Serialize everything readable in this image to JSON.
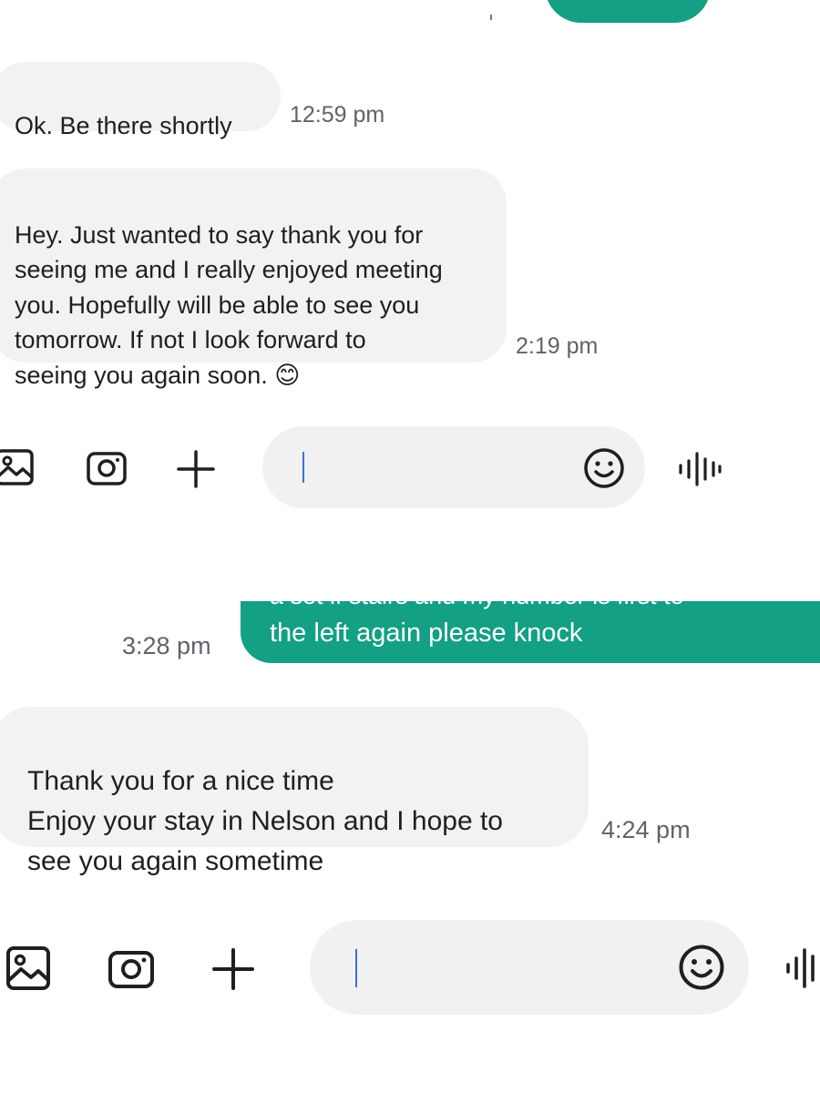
{
  "messages": [
    {
      "direction": "incoming",
      "text": "Ok. Be there shortly",
      "time": "12:59 pm"
    },
    {
      "direction": "incoming",
      "text": "Hey. Just wanted to say thank you for\nseeing me and I really enjoyed meeting\nyou.   Hopefully will be able to see you\ntomorrow.   If not I look forward to\nseeing you again soon. 😊",
      "time": "2:19 pm"
    },
    {
      "direction": "outgoing",
      "text_partial_top": "a set if stairs and my number is first to",
      "text": "the left again please knock",
      "time": "3:28 pm"
    },
    {
      "direction": "incoming",
      "text": "Thank you for a nice time\nEnjoy your stay in Nelson and I hope to\nsee you again sometime",
      "time": "4:24 pm"
    }
  ],
  "composer": {
    "icons": [
      "gallery-icon",
      "camera-icon",
      "plus-icon",
      "emoji-icon",
      "voice-waveform-icon"
    ]
  },
  "colors": {
    "outgoing_bubble": "#13a085",
    "incoming_bubble": "#f2f2f2",
    "input_background": "#f1f1f1",
    "cursor": "#3a6fd8",
    "timestamp": "#5f6368"
  }
}
